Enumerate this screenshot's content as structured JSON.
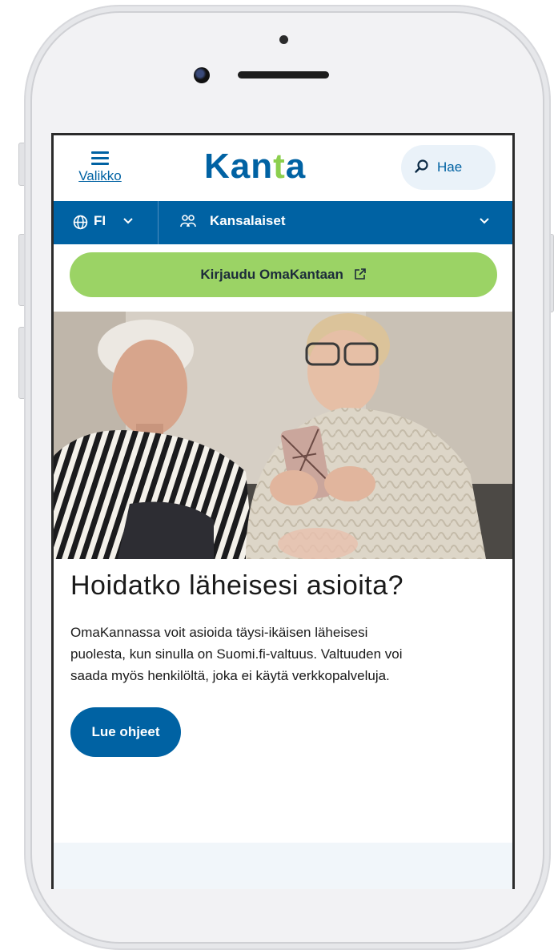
{
  "header": {
    "menu_label": "Valikko",
    "logo_text_start": "Kan",
    "logo_text_accent": "t",
    "logo_text_end": "a",
    "search_label": "Hae"
  },
  "nav": {
    "language": "FI",
    "section": "Kansalaiset"
  },
  "login_button": "Kirjaudu OmaKantaan",
  "article": {
    "title": "Hoidatko läheisesi asioita?",
    "description": "OmaKannassa voit asioida täysi-ikäisen läheisesi puolesta, kun sinulla on Suomi.fi-valtuus. Valtuuden voi saada myös henkilöltä, joka ei käytä verkkopalveluja.",
    "button": "Lue ohjeet"
  },
  "colors": {
    "brand_blue": "#0062a3",
    "brand_green": "#9bd365",
    "logo_accent": "#8ccf4e"
  },
  "icons": [
    "hamburger-menu-icon",
    "search-icon",
    "globe-icon",
    "chevron-down-icon",
    "people-icon",
    "external-link-icon"
  ]
}
